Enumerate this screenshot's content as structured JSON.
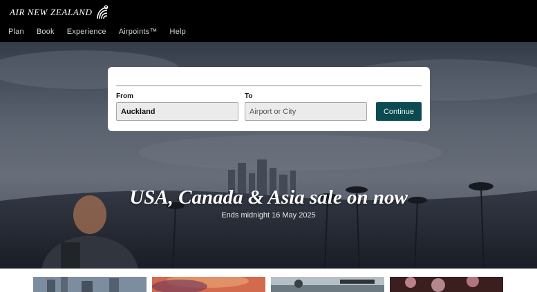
{
  "brand": {
    "name": "AIR NEW ZEALAND",
    "logo_icon": "koru-icon"
  },
  "nav": {
    "items": [
      {
        "label": "Plan"
      },
      {
        "label": "Book"
      },
      {
        "label": "Experience"
      },
      {
        "label": "Airpoints™"
      },
      {
        "label": "Help"
      }
    ]
  },
  "search": {
    "from_label": "From",
    "from_value": "Auckland",
    "to_label": "To",
    "to_placeholder": "Airport or City",
    "continue_label": "Continue"
  },
  "hero": {
    "headline": "USA, Canada & Asia sale on now",
    "subline": "Ends midnight 16 May 2025"
  },
  "colors": {
    "header_bg": "#000000",
    "accent_button": "#0c4a52",
    "card_bg": "#ffffff"
  }
}
